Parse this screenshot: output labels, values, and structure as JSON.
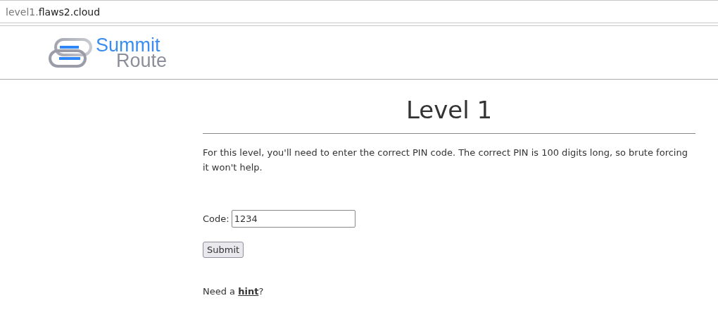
{
  "address_bar": {
    "subdomain": "level1.",
    "domain": "flaws2.cloud"
  },
  "logo": {
    "line_1": "Summit",
    "line_2": "Route"
  },
  "title": "Level 1",
  "intro": "For this level, you'll need to enter the correct PIN code. The correct PIN is 100 digits long, so brute forcing it won't help.",
  "form": {
    "label": "Code:",
    "value": "1234",
    "button": "Submit"
  },
  "hint": {
    "before": "Need a ",
    "link": "hint",
    "after": "?"
  }
}
